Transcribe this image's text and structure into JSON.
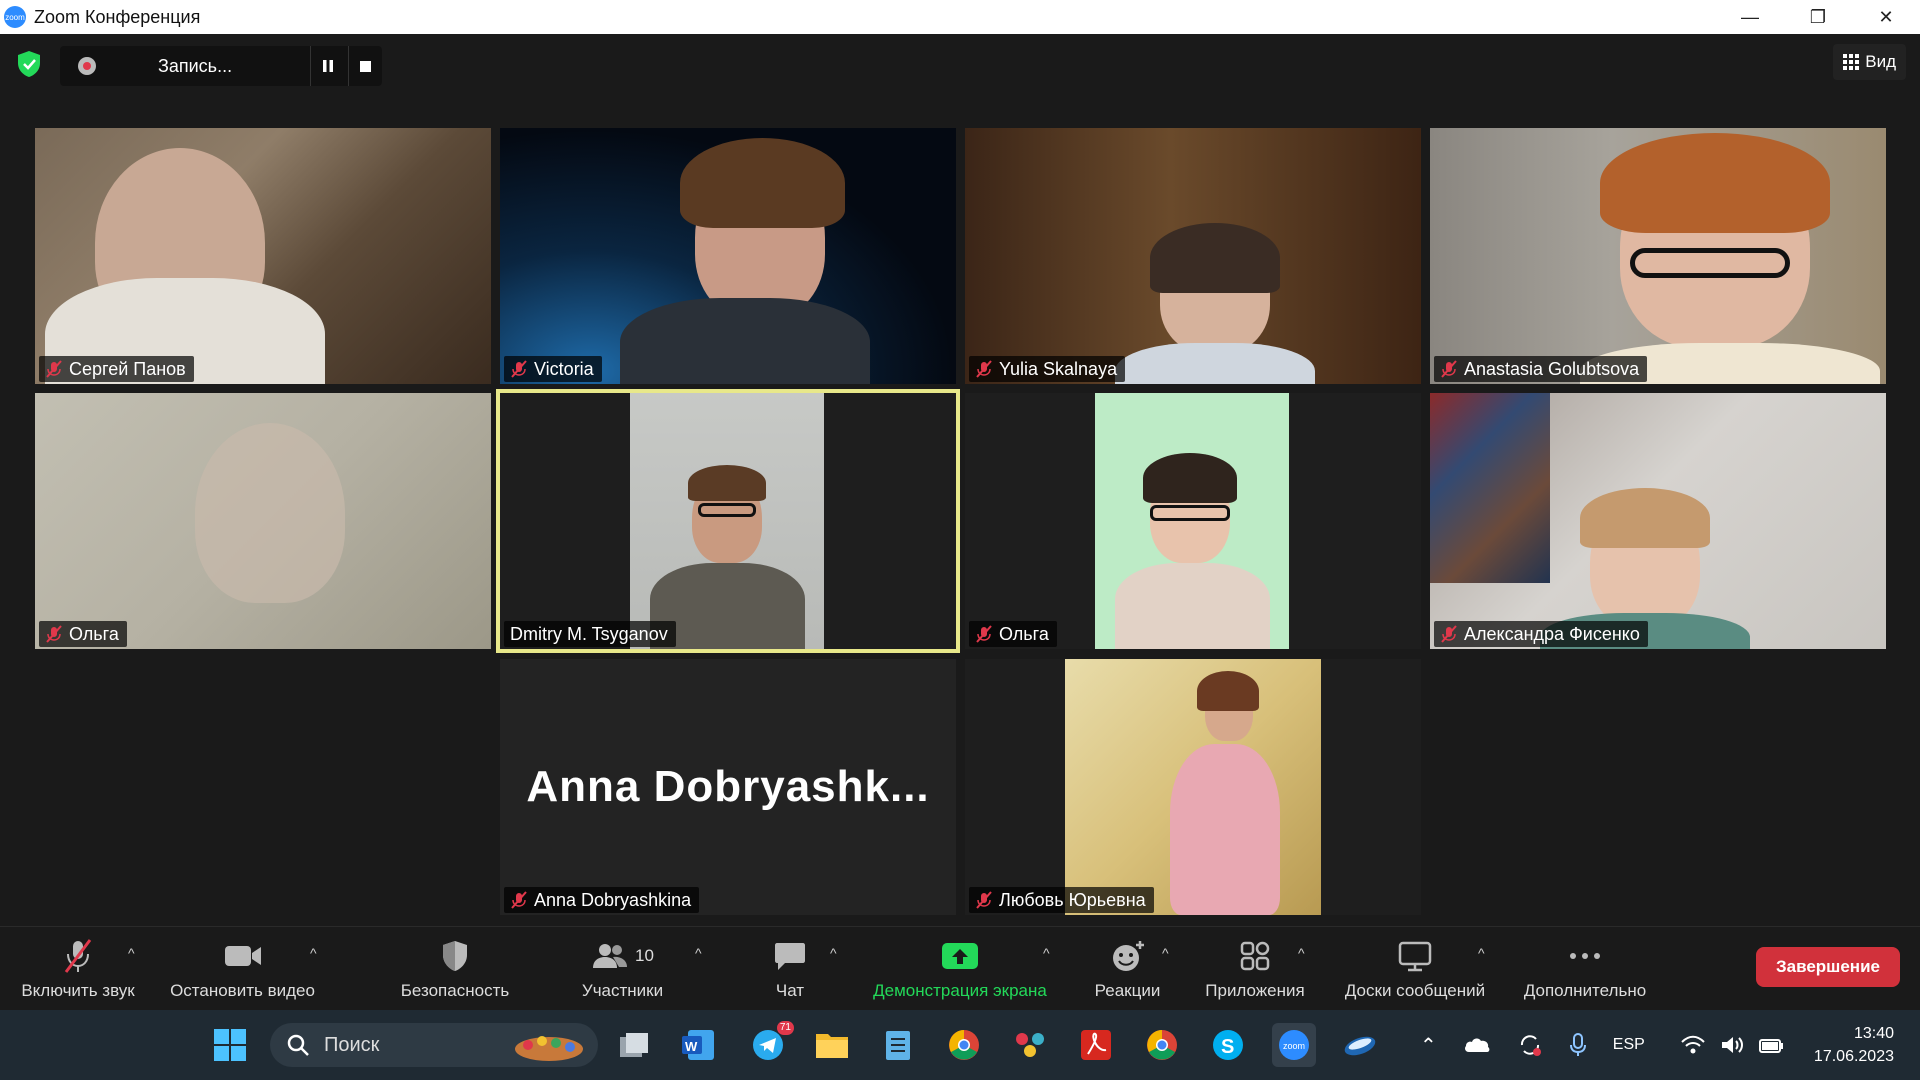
{
  "window": {
    "title": "Zoom Конференция",
    "minimize_label": "—",
    "restore_label": "❐",
    "close_label": "✕"
  },
  "recording": {
    "status_text": "Запись...",
    "pause_icon": "pause-icon",
    "stop_icon": "stop-icon"
  },
  "view": {
    "label": "Вид"
  },
  "participants": [
    {
      "name": "Сергей Панов",
      "muted": true
    },
    {
      "name": "Victoria",
      "muted": true
    },
    {
      "name": "Yulia Skalnaya",
      "muted": true
    },
    {
      "name": "Anastasia Golubtsova",
      "muted": true
    },
    {
      "name": "Ольга",
      "muted": true
    },
    {
      "name": "Dmitry M. Tsyganov",
      "muted": false,
      "active_speaker": true
    },
    {
      "name": "Ольга",
      "muted": true
    },
    {
      "name": "Александра Фисенко",
      "muted": true
    },
    {
      "name": "Anna Dobryashkina",
      "muted": true,
      "video_off": true,
      "card_text": "Anna  Dobryashk..."
    },
    {
      "name": "Любовь Юрьевна",
      "muted": true
    }
  ],
  "toolbar": {
    "unmute": "Включить звук",
    "stop_video": "Остановить видео",
    "security": "Безопасность",
    "participants": "Участники",
    "participants_count": "10",
    "chat": "Чат",
    "share_screen": "Демонстрация экрана",
    "reactions": "Реакции",
    "apps": "Приложения",
    "whiteboards": "Доски сообщений",
    "more": "Дополнительно",
    "end": "Завершение"
  },
  "taskbar": {
    "search_placeholder": "Поиск",
    "telegram_badge": "71",
    "language": "ESP",
    "time": "13:40",
    "date": "17.06.2023"
  },
  "colors": {
    "share_green": "#23d959",
    "end_red": "#d1313b",
    "active_speaker": "#e8e88a",
    "muted_red": "#e0384b"
  }
}
